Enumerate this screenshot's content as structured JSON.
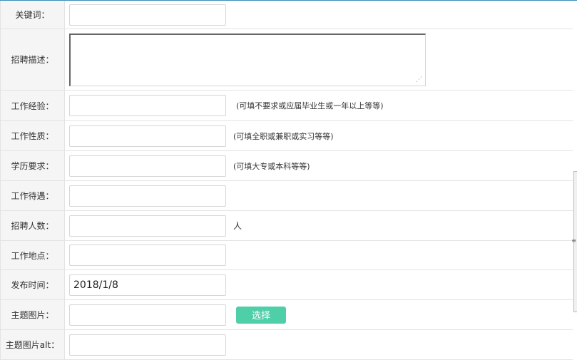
{
  "form": {
    "keywords": {
      "label": "关键词：",
      "value": ""
    },
    "description": {
      "label": "招聘描述：",
      "value": ""
    },
    "experience": {
      "label": "工作经验：",
      "value": "",
      "hint": "(可填不要求或应届毕业生或一年以上等等)"
    },
    "job_type": {
      "label": "工作性质：",
      "value": "",
      "hint": "(可填全职或兼职或实习等等)"
    },
    "education": {
      "label": "学历要求：",
      "value": "",
      "hint": "(可填大专或本科等等)"
    },
    "salary": {
      "label": "工作待遇：",
      "value": ""
    },
    "headcount": {
      "label": "招聘人数：",
      "value": "",
      "unit": "人"
    },
    "location": {
      "label": "工作地点：",
      "value": ""
    },
    "publish_time": {
      "label": "发布时间：",
      "value": "2018/1/8"
    },
    "theme_image": {
      "label": "主题图片：",
      "value": "",
      "button_label": "选择"
    },
    "theme_image_alt": {
      "label": "主题图片alt：",
      "value": ""
    }
  },
  "colors": {
    "accent_button": "#4fcfa8",
    "label_bg": "#f5f5f5",
    "top_border": "#3c8dbc"
  }
}
